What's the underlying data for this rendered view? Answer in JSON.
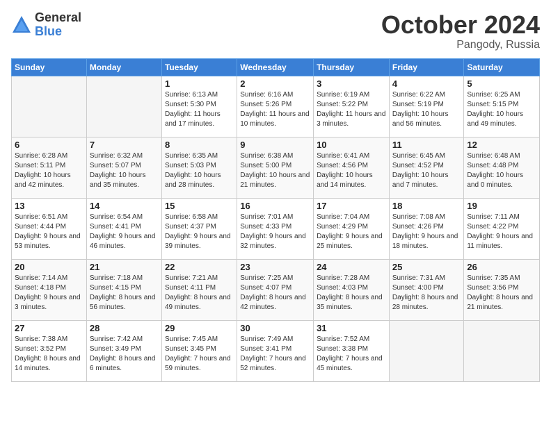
{
  "header": {
    "logo_general": "General",
    "logo_blue": "Blue",
    "month": "October 2024",
    "location": "Pangody, Russia"
  },
  "weekdays": [
    "Sunday",
    "Monday",
    "Tuesday",
    "Wednesday",
    "Thursday",
    "Friday",
    "Saturday"
  ],
  "weeks": [
    [
      {
        "day": "",
        "empty": true
      },
      {
        "day": "",
        "empty": true
      },
      {
        "day": "1",
        "sunrise": "6:13 AM",
        "sunset": "5:30 PM",
        "daylight": "11 hours and 17 minutes."
      },
      {
        "day": "2",
        "sunrise": "6:16 AM",
        "sunset": "5:26 PM",
        "daylight": "11 hours and 10 minutes."
      },
      {
        "day": "3",
        "sunrise": "6:19 AM",
        "sunset": "5:22 PM",
        "daylight": "11 hours and 3 minutes."
      },
      {
        "day": "4",
        "sunrise": "6:22 AM",
        "sunset": "5:19 PM",
        "daylight": "10 hours and 56 minutes."
      },
      {
        "day": "5",
        "sunrise": "6:25 AM",
        "sunset": "5:15 PM",
        "daylight": "10 hours and 49 minutes."
      }
    ],
    [
      {
        "day": "6",
        "sunrise": "6:28 AM",
        "sunset": "5:11 PM",
        "daylight": "10 hours and 42 minutes."
      },
      {
        "day": "7",
        "sunrise": "6:32 AM",
        "sunset": "5:07 PM",
        "daylight": "10 hours and 35 minutes."
      },
      {
        "day": "8",
        "sunrise": "6:35 AM",
        "sunset": "5:03 PM",
        "daylight": "10 hours and 28 minutes."
      },
      {
        "day": "9",
        "sunrise": "6:38 AM",
        "sunset": "5:00 PM",
        "daylight": "10 hours and 21 minutes."
      },
      {
        "day": "10",
        "sunrise": "6:41 AM",
        "sunset": "4:56 PM",
        "daylight": "10 hours and 14 minutes."
      },
      {
        "day": "11",
        "sunrise": "6:45 AM",
        "sunset": "4:52 PM",
        "daylight": "10 hours and 7 minutes."
      },
      {
        "day": "12",
        "sunrise": "6:48 AM",
        "sunset": "4:48 PM",
        "daylight": "10 hours and 0 minutes."
      }
    ],
    [
      {
        "day": "13",
        "sunrise": "6:51 AM",
        "sunset": "4:44 PM",
        "daylight": "9 hours and 53 minutes."
      },
      {
        "day": "14",
        "sunrise": "6:54 AM",
        "sunset": "4:41 PM",
        "daylight": "9 hours and 46 minutes."
      },
      {
        "day": "15",
        "sunrise": "6:58 AM",
        "sunset": "4:37 PM",
        "daylight": "9 hours and 39 minutes."
      },
      {
        "day": "16",
        "sunrise": "7:01 AM",
        "sunset": "4:33 PM",
        "daylight": "9 hours and 32 minutes."
      },
      {
        "day": "17",
        "sunrise": "7:04 AM",
        "sunset": "4:29 PM",
        "daylight": "9 hours and 25 minutes."
      },
      {
        "day": "18",
        "sunrise": "7:08 AM",
        "sunset": "4:26 PM",
        "daylight": "9 hours and 18 minutes."
      },
      {
        "day": "19",
        "sunrise": "7:11 AM",
        "sunset": "4:22 PM",
        "daylight": "9 hours and 11 minutes."
      }
    ],
    [
      {
        "day": "20",
        "sunrise": "7:14 AM",
        "sunset": "4:18 PM",
        "daylight": "9 hours and 3 minutes."
      },
      {
        "day": "21",
        "sunrise": "7:18 AM",
        "sunset": "4:15 PM",
        "daylight": "8 hours and 56 minutes."
      },
      {
        "day": "22",
        "sunrise": "7:21 AM",
        "sunset": "4:11 PM",
        "daylight": "8 hours and 49 minutes."
      },
      {
        "day": "23",
        "sunrise": "7:25 AM",
        "sunset": "4:07 PM",
        "daylight": "8 hours and 42 minutes."
      },
      {
        "day": "24",
        "sunrise": "7:28 AM",
        "sunset": "4:03 PM",
        "daylight": "8 hours and 35 minutes."
      },
      {
        "day": "25",
        "sunrise": "7:31 AM",
        "sunset": "4:00 PM",
        "daylight": "8 hours and 28 minutes."
      },
      {
        "day": "26",
        "sunrise": "7:35 AM",
        "sunset": "3:56 PM",
        "daylight": "8 hours and 21 minutes."
      }
    ],
    [
      {
        "day": "27",
        "sunrise": "7:38 AM",
        "sunset": "3:52 PM",
        "daylight": "8 hours and 14 minutes."
      },
      {
        "day": "28",
        "sunrise": "7:42 AM",
        "sunset": "3:49 PM",
        "daylight": "8 hours and 6 minutes."
      },
      {
        "day": "29",
        "sunrise": "7:45 AM",
        "sunset": "3:45 PM",
        "daylight": "7 hours and 59 minutes."
      },
      {
        "day": "30",
        "sunrise": "7:49 AM",
        "sunset": "3:41 PM",
        "daylight": "7 hours and 52 minutes."
      },
      {
        "day": "31",
        "sunrise": "7:52 AM",
        "sunset": "3:38 PM",
        "daylight": "7 hours and 45 minutes."
      },
      {
        "day": "",
        "empty": true
      },
      {
        "day": "",
        "empty": true
      }
    ]
  ]
}
